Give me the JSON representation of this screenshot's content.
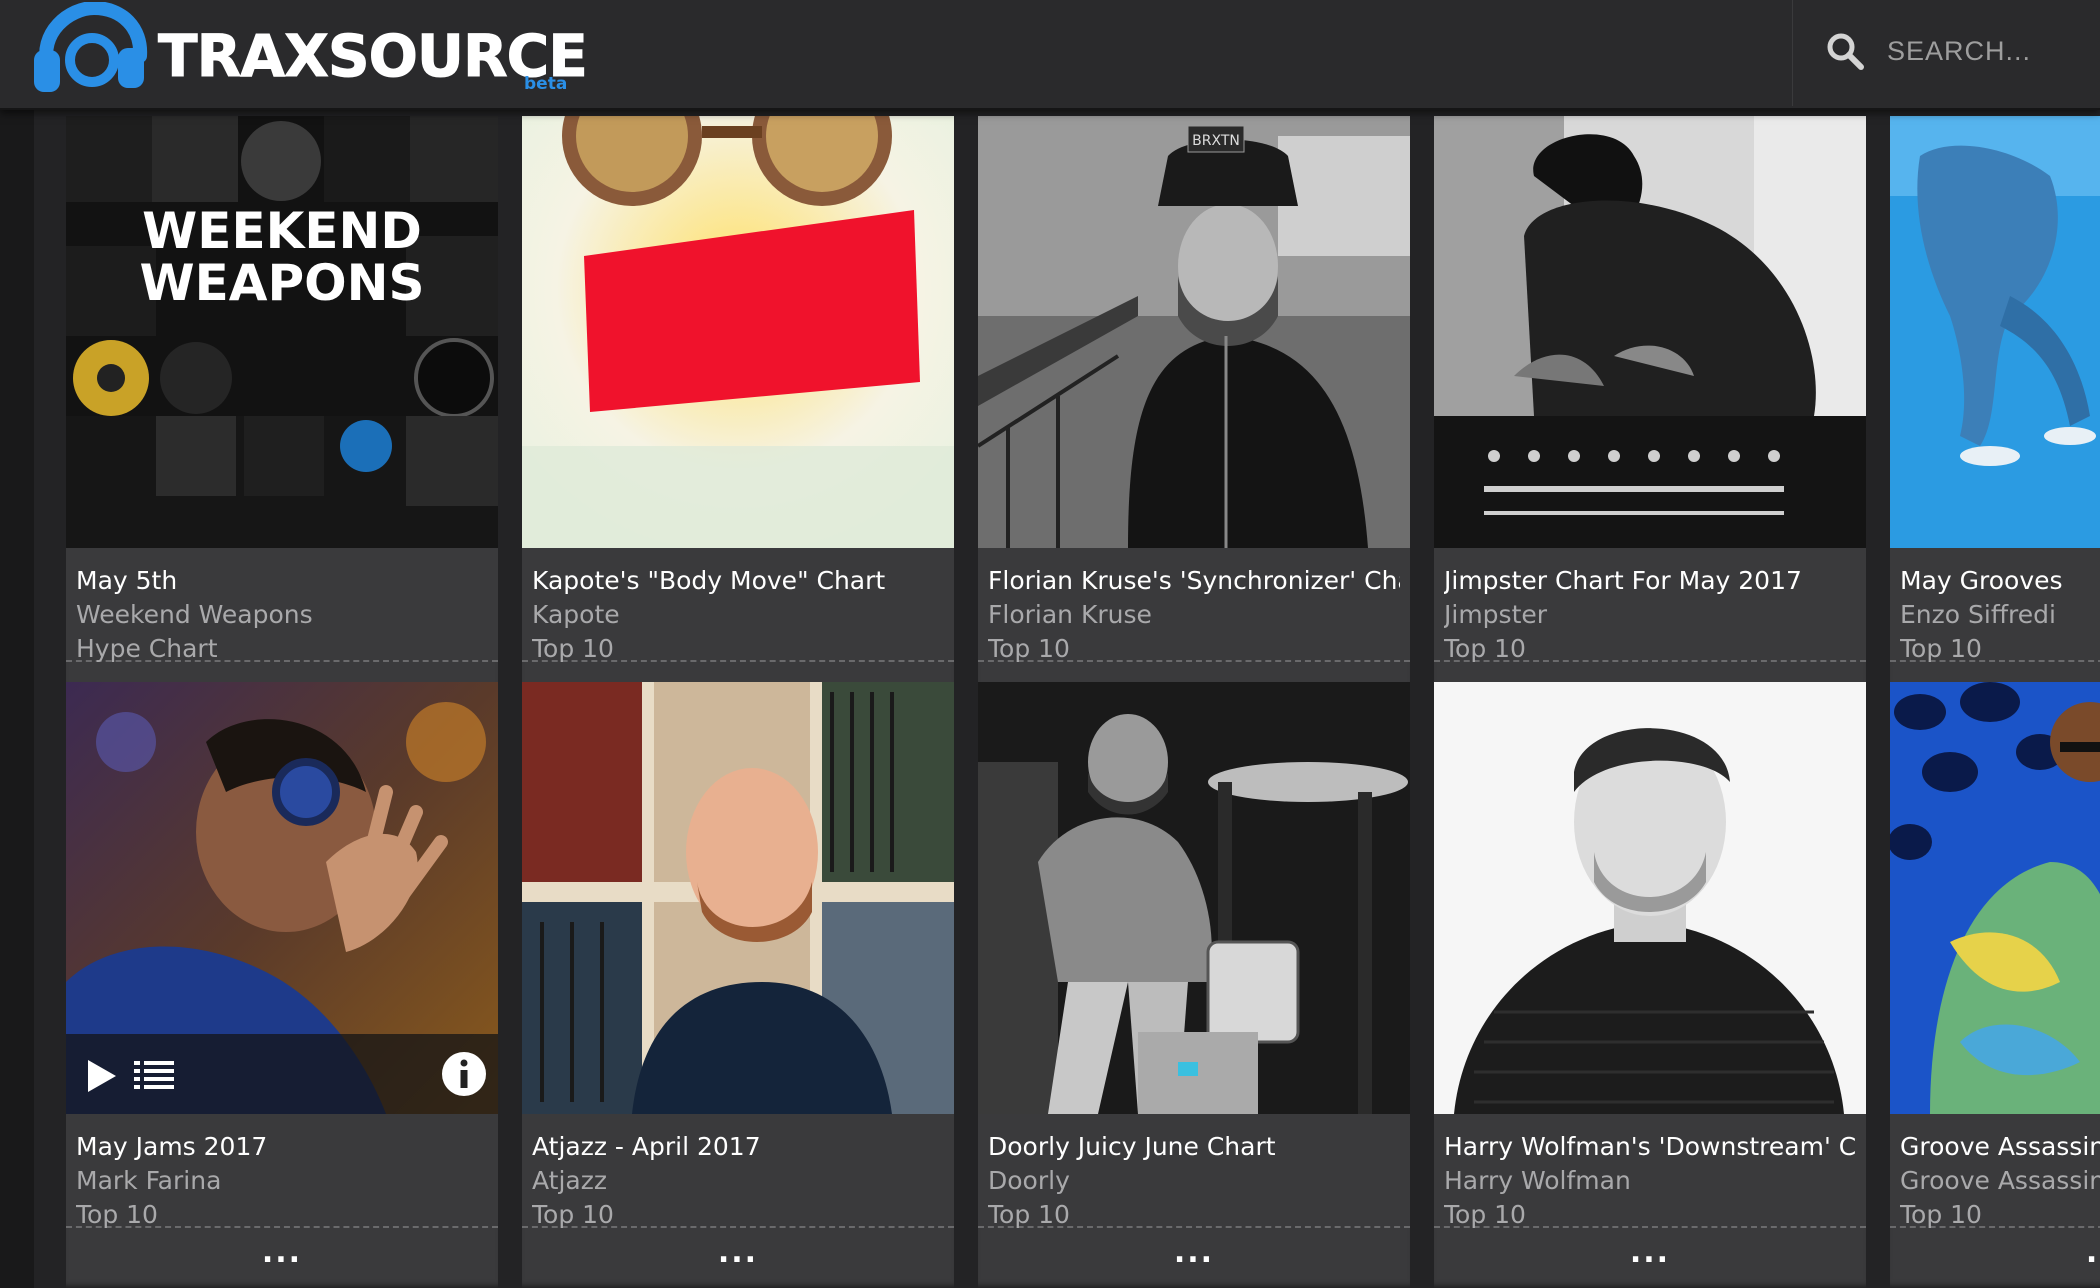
{
  "header": {
    "logo_text": "TRAXSOURCE",
    "logo_badge": "beta",
    "search_placeholder": "SEARCH..."
  },
  "colors": {
    "header_bg": "#2a2a2c",
    "card_bg": "#3a3a3c",
    "accent_blue": "#2a8fe6",
    "title_text": "#ffffff",
    "subtitle_text": "#a9a9ab"
  },
  "overlay_icons": [
    "play-icon",
    "tracklist-icon",
    "info-icon"
  ],
  "rows": [
    {
      "cards": [
        {
          "title": "May 5th",
          "artist": "Weekend Weapons",
          "type": "Hype Chart",
          "menu": "...",
          "art_text": [
            "WEEKEND",
            "WEAPONS"
          ]
        },
        {
          "title": "Kapote's \"Body Move\" Chart",
          "artist": "Kapote",
          "type": "Top 10",
          "menu": "..."
        },
        {
          "title": "Florian Kruse's 'Synchronizer' Chart",
          "artist": "Florian Kruse",
          "type": "Top 10",
          "menu": "...",
          "art_text": [
            "BRXTN"
          ]
        },
        {
          "title": "Jimpster Chart For May 2017",
          "artist": "Jimpster",
          "type": "Top 10",
          "menu": "..."
        },
        {
          "title": "May Grooves",
          "artist": "Enzo Siffredi",
          "type": "Top 10",
          "menu": "..."
        }
      ]
    },
    {
      "cards": [
        {
          "title": "May Jams 2017",
          "artist": "Mark Farina",
          "type": "Top 10",
          "menu": "..."
        },
        {
          "title": "Atjazz - April 2017",
          "artist": "Atjazz",
          "type": "Top 10",
          "menu": "..."
        },
        {
          "title": "Doorly Juicy June Chart",
          "artist": "Doorly",
          "type": "Top 10",
          "menu": "..."
        },
        {
          "title": "Harry Wolfman's 'Downstream' Ch...",
          "artist": "Harry Wolfman",
          "type": "Top 10",
          "menu": "..."
        },
        {
          "title": "Groove Assassin M",
          "artist": "Groove Assassin",
          "type": "Top 10",
          "menu": "..."
        }
      ]
    }
  ]
}
